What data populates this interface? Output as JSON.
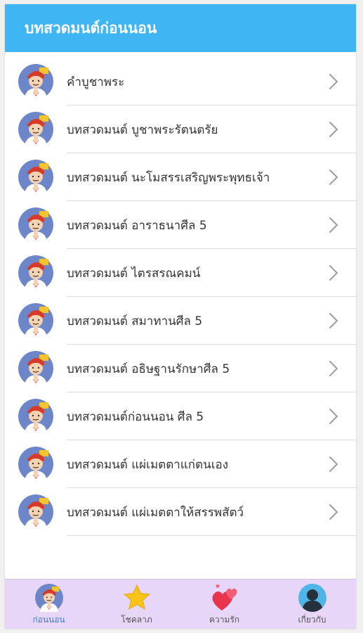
{
  "header": {
    "title": "บทสวดมนต์ก่อนนอน"
  },
  "list": {
    "items": [
      {
        "label": "คำบูชาพระ"
      },
      {
        "label": "บทสวดมนต์ บูชาพระรัตนตรัย"
      },
      {
        "label": "บทสวดมนต์ นะโมสรรเสริญพระพุทธเจ้า"
      },
      {
        "label": "บทสวดมนต์ อาราธนาศีล 5"
      },
      {
        "label": "บทสวดมนต์ ไตรสรณคมน์"
      },
      {
        "label": "บทสวดมนต์ สมาทานศีล 5"
      },
      {
        "label": "บทสวดมนต์ อธิษฐานรักษาศีล 5"
      },
      {
        "label": "บทสวดมนต์ก่อนนอน ศีล 5"
      },
      {
        "label": "บทสวดมนต์ แผ่เมตตาแก่ตนเอง"
      },
      {
        "label": "บทสวดมนต์ แผ่เมตตาให้สรรพสัตว์"
      }
    ],
    "item_icon": "praying-monk-icon",
    "chevron_icon": "chevron-right-icon"
  },
  "tabbar": {
    "tabs": [
      {
        "label": "ก่อนนอน",
        "icon": "praying-monk-icon",
        "active": true
      },
      {
        "label": "โชคลาภ",
        "icon": "star-icon",
        "active": false
      },
      {
        "label": "ความรัก",
        "icon": "hearts-icon",
        "active": false
      },
      {
        "label": "เกี่ยวกับ",
        "icon": "user-avatar-icon",
        "active": false
      }
    ]
  },
  "colors": {
    "header_bg": "#3fb6f3",
    "tabbar_bg": "#e8d6f8",
    "active_tab": "#3b7de0"
  }
}
